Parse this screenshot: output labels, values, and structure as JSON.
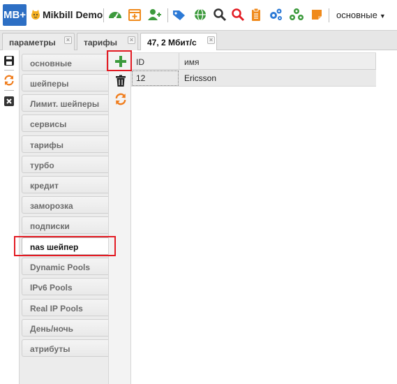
{
  "header": {
    "logo_text": "MB+",
    "brand": "Mikbill Demo",
    "user_menu": "основные",
    "toolbar_icons": [
      "dashboard-icon",
      "calendar-add-icon",
      "add-user-icon",
      "tags-icon",
      "globe-icon",
      "search-icon",
      "search-red-icon",
      "clipboard-icon",
      "settings-cogs-icon",
      "network-icon",
      "note-icon"
    ]
  },
  "tabs": [
    {
      "label": "параметры",
      "close": "×",
      "active": false
    },
    {
      "label": "тарифы",
      "close": "×",
      "active": false
    },
    {
      "label": "47, 2 Мбит/с",
      "close": "×",
      "active": true
    }
  ],
  "left_actions": [
    "save-icon",
    "refresh-icon",
    "close-icon"
  ],
  "categories": [
    {
      "label": "основные"
    },
    {
      "label": "шейперы"
    },
    {
      "label": "Лимит. шейперы"
    },
    {
      "label": "сервисы"
    },
    {
      "label": "тарифы"
    },
    {
      "label": "турбо"
    },
    {
      "label": "кредит"
    },
    {
      "label": "заморозка"
    },
    {
      "label": "подписки"
    },
    {
      "label": "nas шейпер"
    },
    {
      "label": "Dynamic Pools"
    },
    {
      "label": "IPv6 Pools"
    },
    {
      "label": "Real IP Pools"
    },
    {
      "label": "День/ночь"
    },
    {
      "label": "атрибуты"
    }
  ],
  "active_category": "nas шейпер",
  "grid_actions": [
    "add-icon",
    "delete-icon",
    "refresh-icon"
  ],
  "grid": {
    "columns": [
      "ID",
      "имя"
    ],
    "rows": [
      {
        "id": "12",
        "name": "Ericsson"
      }
    ]
  },
  "colors": {
    "logo_bg": "#2d6fc4",
    "highlight": "#e31b23",
    "add_green": "#3c9a3c",
    "refresh_orange": "#f07c1b"
  }
}
